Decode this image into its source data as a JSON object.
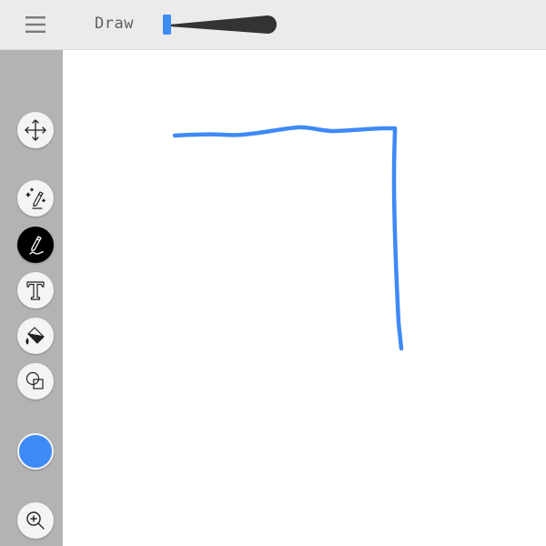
{
  "app": {
    "title": "Draw"
  },
  "toolbar": {
    "menu_icon": "hamburger-menu-icon",
    "width_slider_icon": "stroke-width-slider-icon"
  },
  "sidebar": {
    "tools": [
      {
        "name": "move",
        "icon": "move-arrows-icon",
        "active": false
      },
      {
        "name": "magic-pen",
        "icon": "magic-pen-icon",
        "active": false
      },
      {
        "name": "pen",
        "icon": "pen-icon",
        "active": true
      },
      {
        "name": "text",
        "icon": "text-icon",
        "active": false
      },
      {
        "name": "fill",
        "icon": "paint-bucket-icon",
        "active": false
      },
      {
        "name": "shapes",
        "icon": "shapes-icon",
        "active": false
      },
      {
        "name": "zoom",
        "icon": "zoom-in-icon",
        "active": false
      }
    ],
    "current_color": "#3e8af7"
  },
  "colors": {
    "stroke": "#3e8af7",
    "slider_handle": "#3e8af7",
    "sidebar_bg": "#b3b3b3",
    "topbar_bg": "#ebebeb",
    "active_tool_bg": "#000000"
  }
}
